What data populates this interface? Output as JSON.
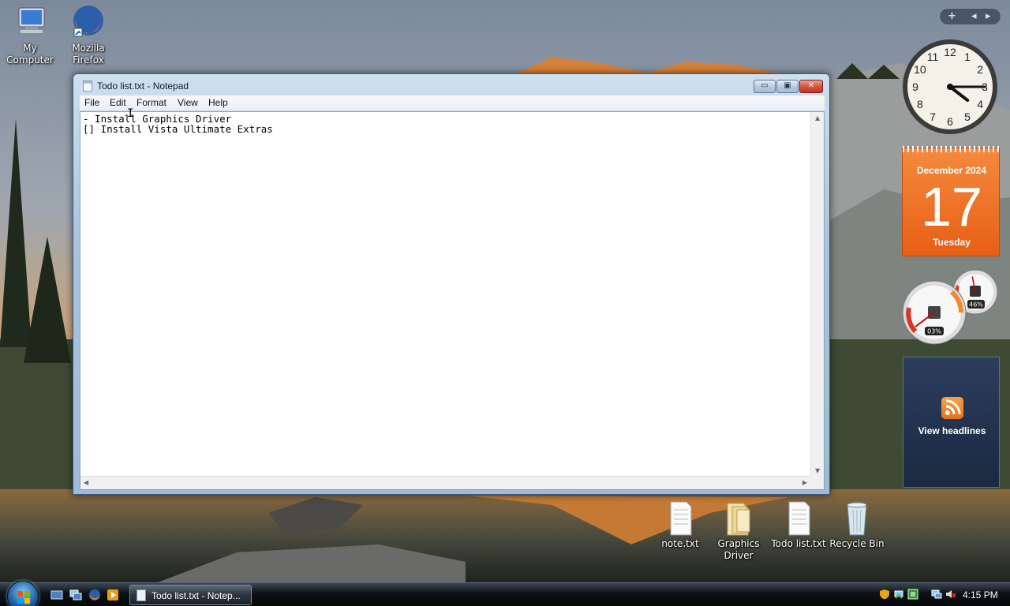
{
  "desktop": {
    "icons": [
      {
        "label": "My\nComputer",
        "icon": "my-computer-icon"
      },
      {
        "label": "Mozilla\nFirefox",
        "icon": "firefox-icon"
      },
      {
        "label": "note.txt",
        "icon": "text-file-icon"
      },
      {
        "label": "Graphics\nDriver",
        "icon": "folder-icon"
      },
      {
        "label": "Todo list.txt",
        "icon": "text-file-icon"
      },
      {
        "label": "Recycle Bin",
        "icon": "recycle-bin-icon"
      }
    ]
  },
  "notepad": {
    "title": "Todo list.txt - Notepad",
    "controls": {
      "minimize": "▭",
      "maximize": "▣",
      "close": "✕"
    },
    "menu": [
      "File",
      "Edit",
      "Format",
      "View",
      "Help"
    ],
    "content": "- Install Graphics Driver\n[] Install Vista Ultimate Extras",
    "cursor": "I"
  },
  "sidebar": {
    "controls": {
      "add": "+",
      "prev": "◂",
      "next": "▸"
    },
    "clock": {
      "numerals": [
        "12",
        "1",
        "2",
        "3",
        "4",
        "5",
        "6",
        "7",
        "8",
        "9",
        "10",
        "11"
      ],
      "hour": 4,
      "minute": 15
    },
    "calendar": {
      "month_year": "December 2024",
      "day": "17",
      "weekday": "Tuesday"
    },
    "meter": {
      "cpu_label": "03%",
      "memory_label": "46%",
      "cpu_percent": 3,
      "memory_percent": 46
    },
    "feed": {
      "label": "View headlines"
    }
  },
  "taskbar": {
    "active_task": "Todo list.txt - Notep...",
    "quick_launch": [
      "show-desktop-icon",
      "switch-windows-icon",
      "firefox-icon",
      "media-player-icon"
    ],
    "tray_icons": [
      "security-shield-icon",
      "network-icon",
      "windows-sidebar-icon",
      "connection-icon",
      "volume-muted-icon"
    ],
    "time": "4:15 PM"
  },
  "colors": {
    "calendar_orange": "#e8661c",
    "title_bar": "#b6cde4",
    "close_button": "#c9432a"
  }
}
